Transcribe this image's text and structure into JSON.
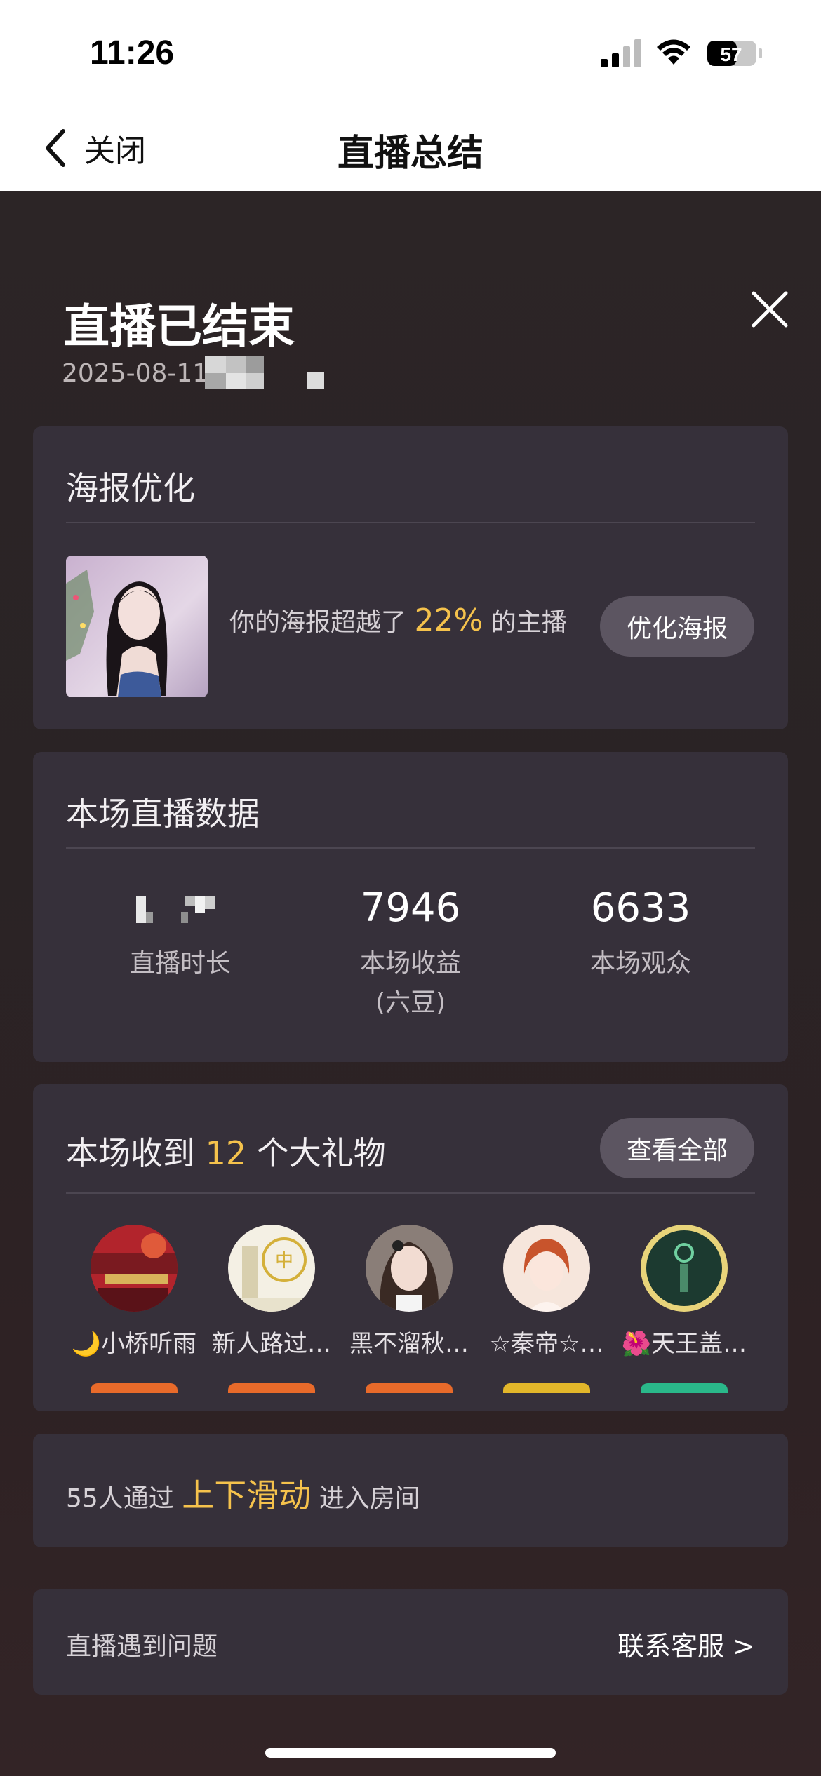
{
  "status_bar": {
    "time": "11:26",
    "battery": "57"
  },
  "nav": {
    "back_label": "关闭",
    "title": "直播总结"
  },
  "header": {
    "title": "直播已结束",
    "date": "2025-08-11"
  },
  "poster": {
    "title": "海报优化",
    "text_before": "你的海报超越了",
    "percent": "22%",
    "text_after": "的主播",
    "button": "优化海报"
  },
  "live_data": {
    "title": "本场直播数据",
    "stats": [
      {
        "value": "",
        "label": "直播时长",
        "sub": ""
      },
      {
        "value": "7946",
        "label": "本场收益",
        "sub": "(六豆)"
      },
      {
        "value": "6633",
        "label": "本场观众",
        "sub": ""
      }
    ]
  },
  "gifts": {
    "title_before": "本场收到",
    "count": "12",
    "title_after": "个大礼物",
    "view_all": "查看全部",
    "users": [
      {
        "name": "🌙小桥听雨"
      },
      {
        "name": "新人路过…"
      },
      {
        "name": "黑不溜秋…"
      },
      {
        "name": "☆秦帝☆…"
      },
      {
        "name": "🌺天王盖…"
      }
    ]
  },
  "swipe": {
    "before": "55人通过",
    "highlight": "上下滑动",
    "after": "进入房间"
  },
  "help": {
    "left": "直播遇到问题",
    "right": "联系客服 >"
  },
  "colors": {
    "accent": "#f5c24c",
    "card": "#36303a",
    "button": "#5c5561"
  }
}
